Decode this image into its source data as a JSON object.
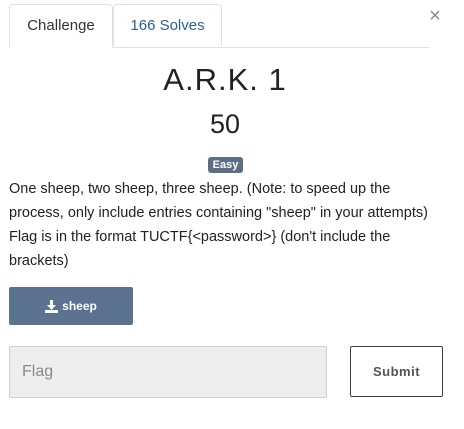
{
  "tabs": [
    {
      "label": "Challenge",
      "active": true
    },
    {
      "label": "166 Solves",
      "active": false
    }
  ],
  "close_icon": "×",
  "challenge": {
    "name": "A.R.K. 1",
    "value": "50",
    "difficulty": "Easy",
    "description": "One sheep, two sheep, three sheep. (Note: to speed up the process, only include entries containing \"sheep\" in your attempts) Flag is in the format TUCTF{<password>} (don't include the brackets)",
    "file_label": "sheep",
    "file_icon": "download-icon"
  },
  "form": {
    "flag_placeholder": "Flag",
    "submit_label": "Submit"
  },
  "colors": {
    "badge": "#5c6e82",
    "file_button": "#5b7290",
    "tab_link": "#2e5e96"
  }
}
